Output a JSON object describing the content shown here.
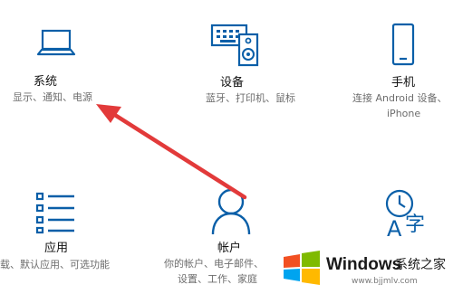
{
  "tiles": {
    "system": {
      "title": "系统",
      "desc": "显示、通知、电源",
      "icon": "laptop-icon"
    },
    "devices": {
      "title": "设备",
      "desc": "蓝牙、打印机、鼠标",
      "icon": "keyboard-speaker-icon"
    },
    "phone": {
      "title": "手机",
      "desc": "连接 Android 设备、",
      "desc2": "iPhone",
      "icon": "phone-icon"
    },
    "apps": {
      "title": "应用",
      "desc": "载、默认应用、可选功能",
      "icon": "apps-list-icon"
    },
    "accounts": {
      "title": "帐户",
      "desc": "你的帐户、电子邮件、",
      "desc2": "设置、工作、家庭",
      "icon": "person-icon"
    },
    "time": {
      "title": "",
      "desc": "",
      "icon": "time-language-icon"
    }
  },
  "watermark": {
    "brand": "Windows",
    "sub": "系统之家",
    "url": "www.bjjmlv.com"
  },
  "colors": {
    "accent": "#0a5fa8",
    "arrow": "#e23a3a"
  }
}
